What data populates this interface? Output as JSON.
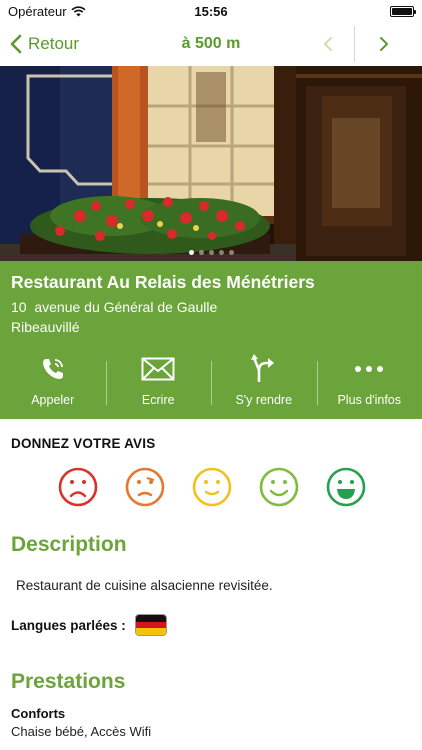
{
  "status_bar": {
    "carrier": "Opérateur",
    "time": "15:56",
    "battery_level": 1.0
  },
  "nav": {
    "back_label": "Retour",
    "title": "à 500 m"
  },
  "hero": {
    "page_count": 5,
    "active_page": 1
  },
  "place": {
    "name": "Restaurant Au Relais des Ménétriers",
    "address_line1": "10  avenue du Général de Gaulle",
    "address_line2": "Ribeauvillé"
  },
  "actions": [
    {
      "label": "Appeler",
      "icon": "phone-icon"
    },
    {
      "label": "Ecrire",
      "icon": "envelope-icon"
    },
    {
      "label": "S'y rendre",
      "icon": "directions-icon"
    },
    {
      "label": "Plus d'infos",
      "icon": "more-icon"
    }
  ],
  "rating": {
    "title": "DONNEZ VOTRE AVIS",
    "options": [
      {
        "name": "very-bad",
        "color": "#d9312b"
      },
      {
        "name": "bad",
        "color": "#e8772e"
      },
      {
        "name": "neutral",
        "color": "#f2c21b"
      },
      {
        "name": "good",
        "color": "#7ebd3c"
      },
      {
        "name": "very-good",
        "color": "#25a050"
      }
    ]
  },
  "description": {
    "title": "Description",
    "text": "Restaurant de cuisine alsacienne revisitée.",
    "languages_label": "Langues parlées :",
    "language_flag": "german-flag"
  },
  "prestations": {
    "title": "Prestations",
    "conforts_label": "Conforts",
    "conforts_text": "Chaise bébé, Accès Wifi"
  },
  "colors": {
    "accent_green": "#6aa43a",
    "nav_green": "#5b9a2e"
  }
}
